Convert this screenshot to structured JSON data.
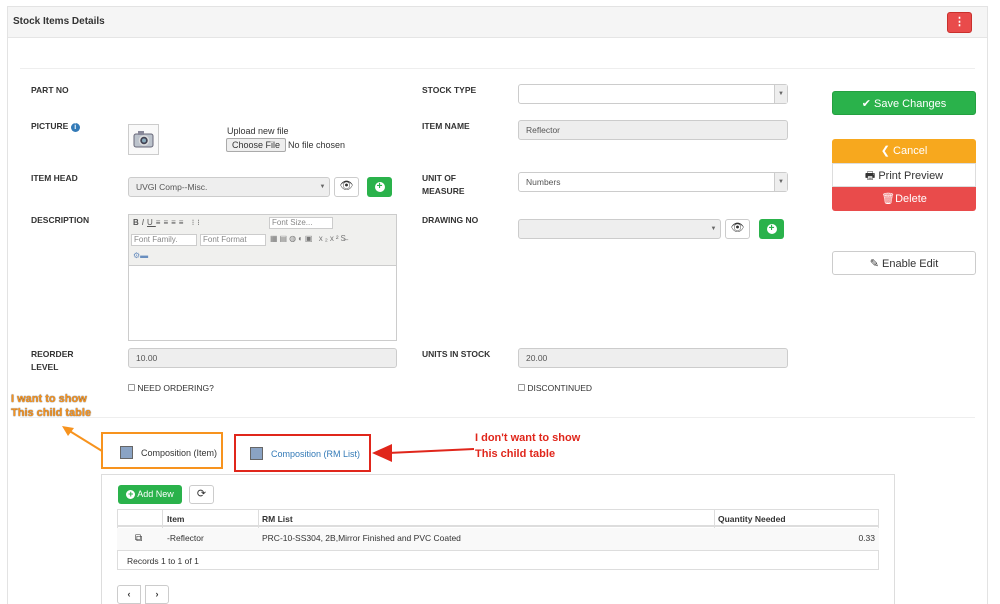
{
  "header": {
    "title": "Stock Items Details",
    "menu_icon": "vertical-dots-icon",
    "menu_label": "⋮"
  },
  "form": {
    "part_no_label": "PART NO",
    "stock_type_label": "STOCK TYPE",
    "stock_type_value": "",
    "picture_label": "PICTURE",
    "upload_label": "Upload new file",
    "choose_file_label": "Choose File",
    "no_file_label": "No file chosen",
    "item_name_label": "ITEM NAME",
    "item_name_value": "Reflector",
    "item_head_label": "ITEM HEAD",
    "item_head_value": "UVGI Comp--Misc.",
    "uom_label_1": "UNIT OF",
    "uom_label_2": "MEASURE",
    "uom_value": "Numbers",
    "description_label": "DESCRIPTION",
    "drawing_no_label": "DRAWING NO",
    "drawing_no_value": "",
    "reorder_label_1": "REORDER",
    "reorder_label_2": "LEVEL",
    "reorder_value": "10.00",
    "units_in_stock_label": "UNITS IN STOCK",
    "units_in_stock_value": "20.00",
    "need_ordering_label": "NEED ORDERING?",
    "discontinued_label": "DISCONTINUED"
  },
  "editor": {
    "font_size": "Font Size...",
    "font_family": "Font Family.",
    "font_format": "Font Format"
  },
  "actions": {
    "save": "Save Changes",
    "cancel": "Cancel",
    "print": "Print Preview",
    "delete": "Delete",
    "enable_edit": "Enable Edit"
  },
  "tabs": [
    {
      "label": "Composition (Item)"
    },
    {
      "label": "Composition (RM List)"
    }
  ],
  "annotations": {
    "left_1": "I want to show",
    "left_2": "This child table",
    "right_1": "I don't want to show",
    "right_2": "This child table",
    "orange": "#f7931e",
    "red": "#e0261b"
  },
  "grid": {
    "add_new": "Add New",
    "columns": [
      "Item",
      "RM List",
      "Quantity Needed"
    ],
    "rows": [
      {
        "item": "-Reflector",
        "rm_list": "PRC-10-SS304, 2B,Mirror Finished and PVC Coated",
        "qty": "0.33"
      }
    ],
    "records": "Records 1 to 1 of 1"
  }
}
